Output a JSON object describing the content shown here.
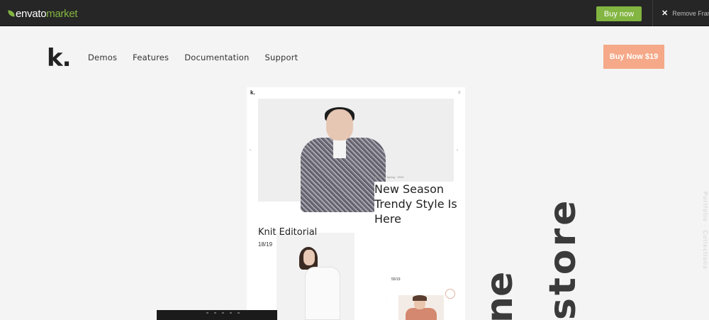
{
  "envato_bar": {
    "logo_main": "envato",
    "logo_sub": "market",
    "buy_label": "Buy now",
    "remove_label": "Remove Frame",
    "accent_color": "#82b541"
  },
  "site": {
    "logo": "k.",
    "nav": [
      "Demos",
      "Features",
      "Documentation",
      "Support"
    ],
    "buy_label": "Buy Now $19",
    "buy_color": "#f5a988"
  },
  "preview": {
    "logo": "k.",
    "tag": "Autumn · Spring · 2019",
    "hero_title": "New Season Trendy Style Is Here",
    "section_title": "Knit Editorial",
    "section_num": "18/19",
    "small_num": "55/19"
  },
  "big_heading": {
    "line1": "store",
    "line2": "ne"
  },
  "side_text": "Portfolio · Collections"
}
